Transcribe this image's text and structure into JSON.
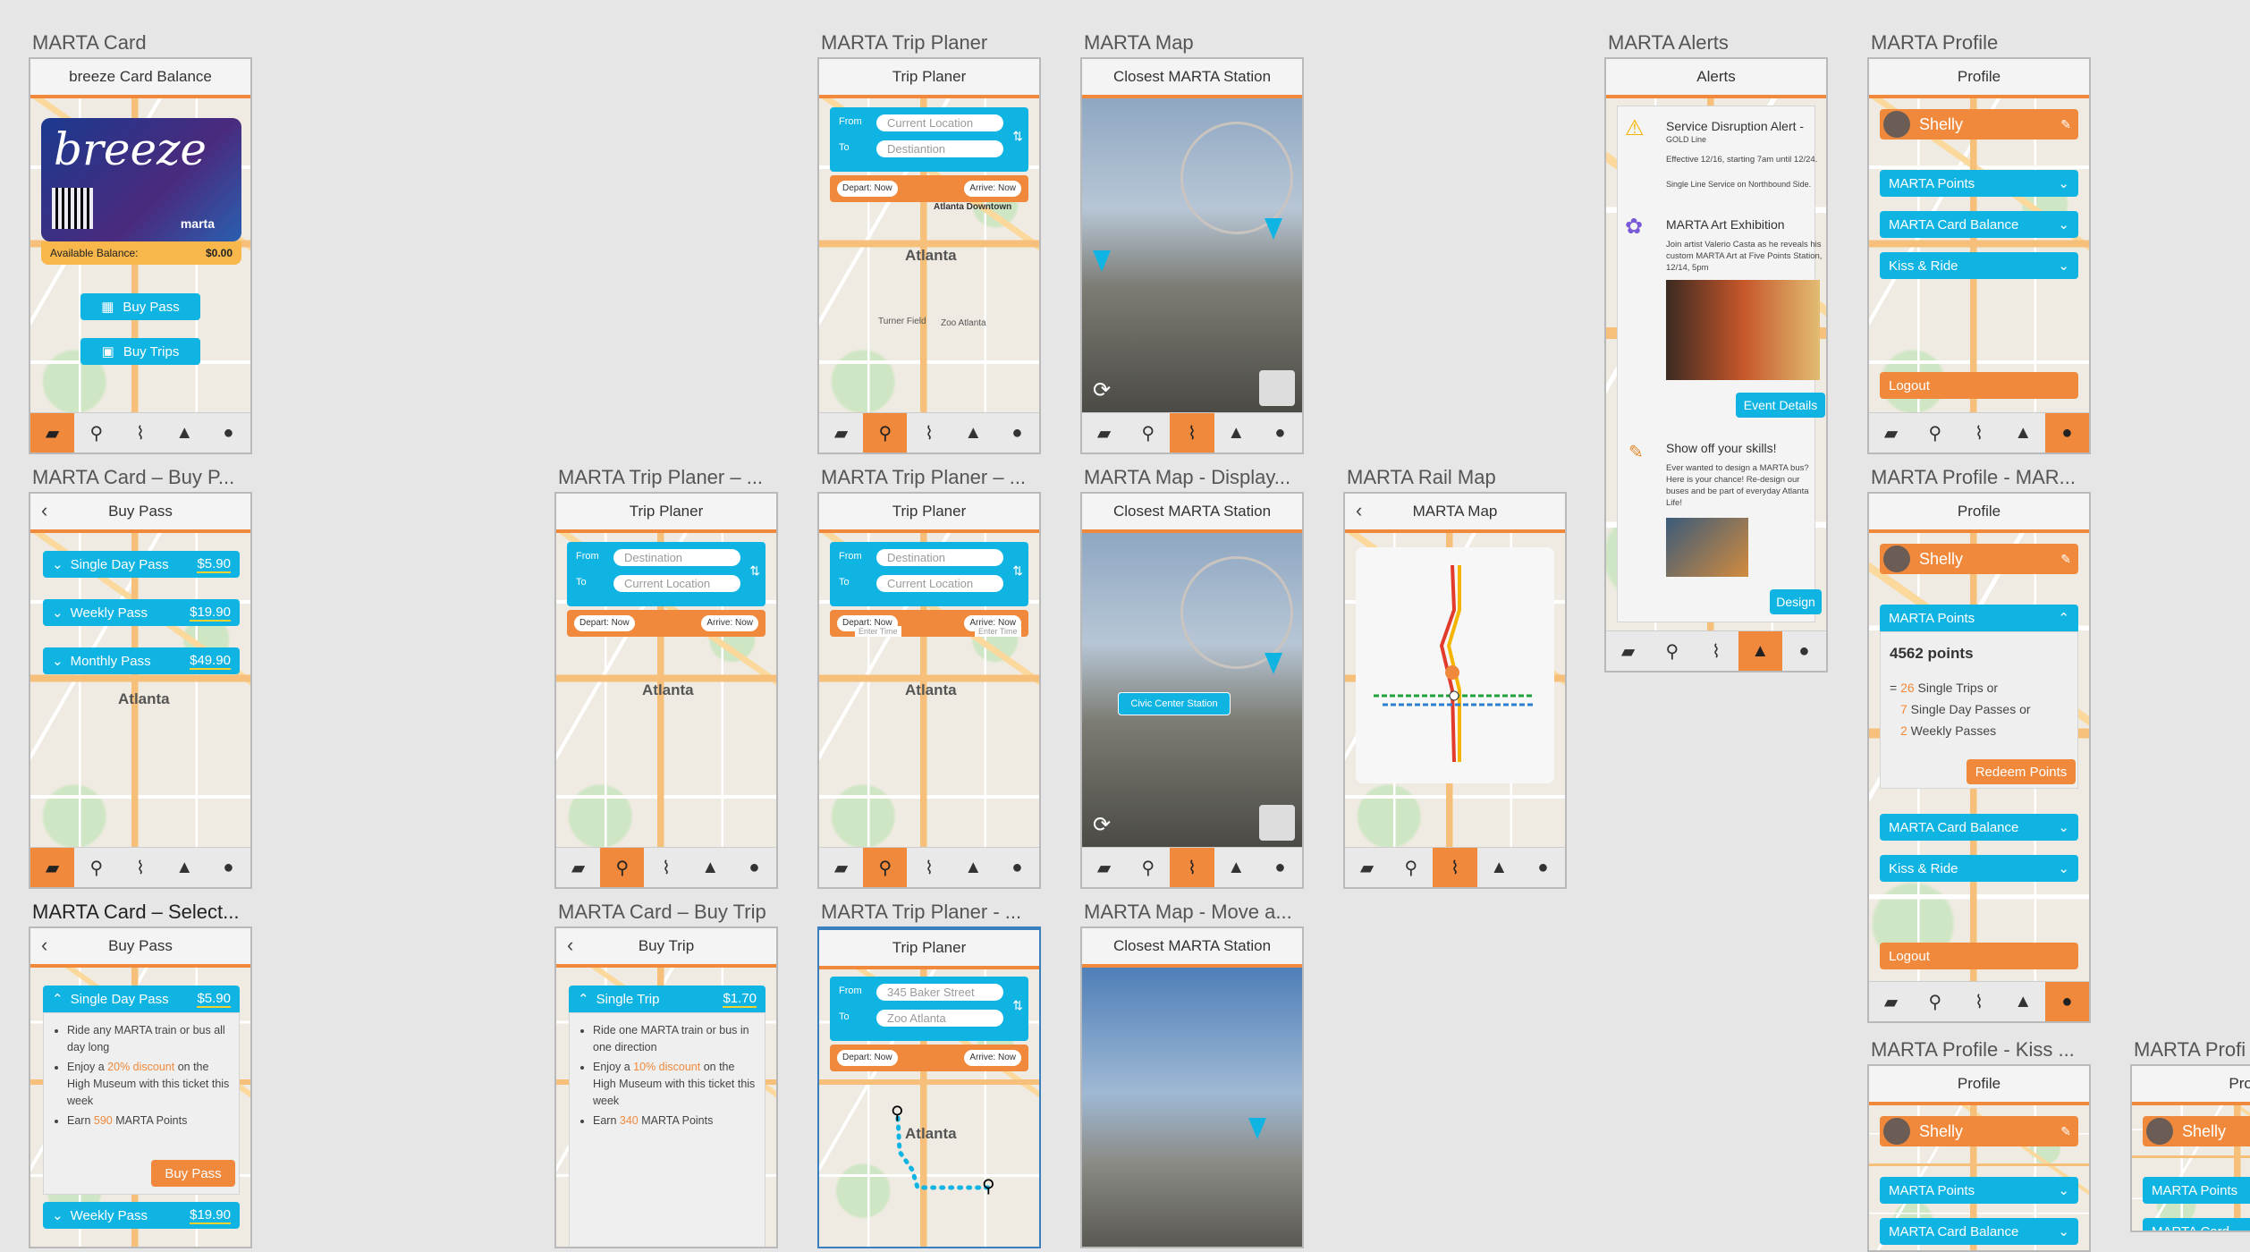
{
  "colors": {
    "accent": "#f0893c",
    "blue": "#10b4e3",
    "background": "#e6e6e6"
  },
  "nav_icons": [
    "ticket-icon",
    "location-pin-icon",
    "map-icon",
    "bell-icon",
    "person-icon"
  ],
  "frames": {
    "card": {
      "title": "MARTA Card",
      "header": "breeze Card Balance",
      "brand": "breeze",
      "brand2": "marta",
      "balance_label": "Available Balance:",
      "balance_value": "$0.00",
      "buy_pass": "Buy Pass",
      "buy_trips": "Buy Trips"
    },
    "card_buy_pass": {
      "title": "MARTA Card – Buy P...",
      "header": "Buy Pass",
      "items": [
        {
          "label": "Single Day Pass",
          "price": "$5.90"
        },
        {
          "label": "Weekly Pass",
          "price": "$19.90"
        },
        {
          "label": "Monthly Pass",
          "price": "$49.90"
        }
      ],
      "city": "Atlanta"
    },
    "card_select": {
      "title": "MARTA Card – Select...",
      "header": "Buy Pass",
      "item": {
        "label": "Single Day Pass",
        "price": "$5.90"
      },
      "b1": "Ride any MARTA train or bus all day long",
      "b2a": "Enjoy a ",
      "b2b": "20% discount",
      "b2c": " on the High Museum with this ticket this week",
      "b3a": "Earn ",
      "b3b": "590",
      "b3c": " MARTA Points",
      "buy": "Buy Pass",
      "item2": {
        "label": "Weekly Pass",
        "price": "$19.90"
      }
    },
    "planer2": {
      "title": "MARTA Trip Planer – ...",
      "header": "Trip Planer",
      "from_label": "From",
      "to_label": "To",
      "from": "Destination",
      "to": "Current Location",
      "depart": "Depart: Now",
      "arrive": "Arrive: Now",
      "city": "Atlanta"
    },
    "buy_trip": {
      "title": "MARTA Card – Buy Trip",
      "header": "Buy Trip",
      "item": {
        "label": "Single Trip",
        "price": "$1.70"
      },
      "b1": "Ride one MARTA train or bus in one direction",
      "b2a": "Enjoy a ",
      "b2b": "10% discount",
      "b2c": " on the High Museum with this ticket this week",
      "b3a": "Earn ",
      "b3b": "340",
      "b3c": " MARTA Points"
    },
    "planer1": {
      "title": "MARTA Trip Planer",
      "header": "Trip Planer",
      "from_label": "From",
      "to_label": "To",
      "from": "Current Location",
      "to": "Destiantion",
      "depart": "Depart: Now",
      "arrive": "Arrive: Now",
      "poi": "Atlanta Downtown",
      "city": "Atlanta",
      "zoo": "Zoo Atlanta",
      "turner": "Turner Field"
    },
    "planer3": {
      "title": "MARTA Trip Planer – ...",
      "header": "Trip Planer",
      "from_label": "From",
      "to_label": "To",
      "from": "Destination",
      "to": "Current Location",
      "depart": "Depart: Now",
      "arrive": "Arrive: Now",
      "enter1": "Enter Time",
      "enter2": "Enter Time",
      "city": "Atlanta"
    },
    "planer4": {
      "title": "MARTA Trip Planer - ...",
      "header": "Trip Planer",
      "from_label": "From",
      "to_label": "To",
      "from": "345 Baker Street",
      "to": "Zoo Atlanta",
      "depart": "Depart: Now",
      "arrive": "Arrive: Now",
      "city": "Atlanta"
    },
    "map1": {
      "title": "MARTA Map",
      "header": "Closest MARTA Station"
    },
    "map2": {
      "title": "MARTA Map - Display...",
      "header": "Closest MARTA Station",
      "station": "Civic Center Station"
    },
    "map3": {
      "title": "MARTA Map - Move a...",
      "header": "Closest MARTA Station"
    },
    "rail": {
      "title": "MARTA Rail Map",
      "header": "MARTA Map"
    },
    "alerts": {
      "title": "MARTA Alerts",
      "header": "Alerts",
      "a1_title": "Service Disruption Alert -",
      "a1_sub": "GOLD Line",
      "a1_body": "Effective 12/16, starting 7am until 12/24.",
      "a1_body2": "Single Line Service on Northbound Side.",
      "a2_title": "MARTA Art Exhibition",
      "a2_body": "Join artist Valerio Casta as he reveals his custom MARTA Art at Five Points Station, 12/14, 5pm",
      "a2_btn": "Event Details",
      "a3_title": "Show off your skills!",
      "a3_body": "Ever wanted to design a MARTA bus? Here is your chance! Re-design our buses and be part of everyday Atlanta Life!",
      "a3_btn": "Design"
    },
    "profile": {
      "title": "MARTA Profile",
      "header": "Profile",
      "name": "Shelly",
      "i1": "MARTA Points",
      "i2": "MARTA Card Balance",
      "i3": "Kiss & Ride",
      "logout": "Logout"
    },
    "profile2": {
      "title": "MARTA Profile - MAR...",
      "header": "Profile",
      "name": "Shelly",
      "i1": "MARTA Points",
      "points": "4562 points",
      "l1a": "= ",
      "l1b": "26",
      "l1c": " Single Trips or",
      "l2b": "7",
      "l2c": " Single Day Passes or",
      "l3b": "2",
      "l3c": " Weekly Passes",
      "redeem": "Redeem Points",
      "i2": "MARTA Card Balance",
      "i3": "Kiss & Ride",
      "logout": "Logout"
    },
    "profile3": {
      "title": "MARTA Profile - Kiss ...",
      "header": "Profile",
      "name": "Shelly",
      "i1": "MARTA Points",
      "i2": "MARTA Card Balance"
    },
    "profile4": {
      "title": "MARTA Profi",
      "header": "Prof",
      "name": "Shelly",
      "i1": "MARTA Points",
      "i2": "MARTA Card"
    }
  }
}
